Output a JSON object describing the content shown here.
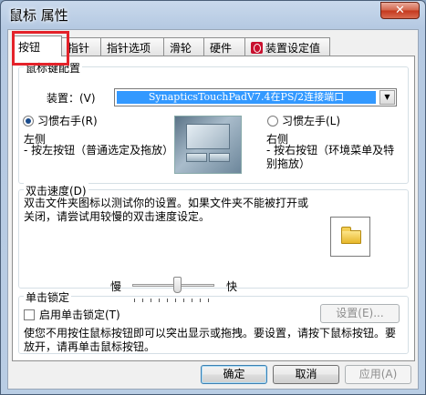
{
  "window": {
    "title": "鼠标 属性",
    "close_label": "✕"
  },
  "tabs": [
    {
      "label": "按钮",
      "active": true
    },
    {
      "label": "指针"
    },
    {
      "label": "指针选项"
    },
    {
      "label": "滑轮"
    },
    {
      "label": "硬件"
    },
    {
      "label": "装置设定值",
      "icon": "synaptics-icon"
    }
  ],
  "button_config": {
    "legend": "鼠标键配置",
    "device_label": "装置：(V)",
    "device_value": "SynapticsTouchPadV7.4在PS/2连接端口",
    "right_hand_label": "习惯右手(R)",
    "left_hand_label": "习惯左手(L)",
    "right_hand_selected": true,
    "left_title": "左侧",
    "left_desc": "- 按左按钮（普通选定及拖放）",
    "right_title": "右侧",
    "right_desc": "- 按右按钮（环境菜单及特别拖放）"
  },
  "double_click": {
    "legend": "双击速度(D)",
    "description": "双击文件夹图标以测试你的设置。如果文件夹不能被打开或关闭，请尝试用较慢的双击速度设定。",
    "slow_label": "慢",
    "fast_label": "快",
    "speed_fraction": 0.55,
    "folder_icon": "folder-icon"
  },
  "click_lock": {
    "legend": "单击锁定",
    "checkbox_label": "启用单击锁定(T)",
    "checked": false,
    "settings_label": "设置(E)...",
    "description": "使您不用按住鼠标按钮即可以突出显示或拖拽。要设置，请按下鼠标按钮。要放开，请再单击鼠标按钮。"
  },
  "footer": {
    "ok_label": "确定",
    "cancel_label": "取消",
    "apply_label": "应用(A)"
  },
  "accent": {
    "selection": "#3399ff",
    "highlight_box": "#e4222a"
  }
}
